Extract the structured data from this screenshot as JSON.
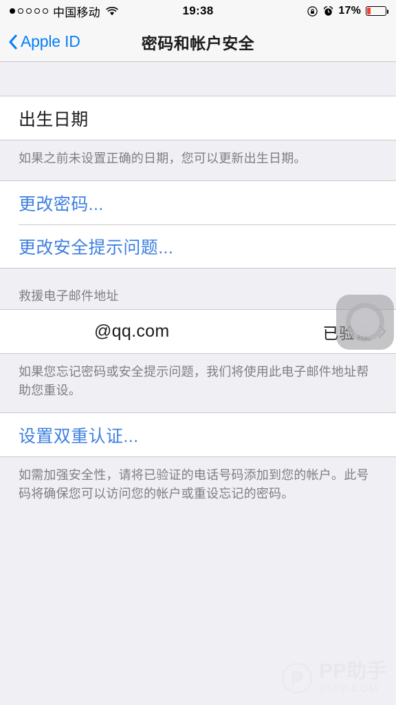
{
  "status_bar": {
    "signal_dots_total": 5,
    "signal_dots_filled": 1,
    "carrier": "中国移动",
    "wifi_icon": "wifi-icon",
    "time": "19:38",
    "rotation_lock_icon": "rotation-lock-icon",
    "alarm_icon": "alarm-clock-icon",
    "battery_percent": "17%",
    "battery_level": 17,
    "battery_color": "#FF3B30"
  },
  "navbar": {
    "back_icon": "chevron-left-icon",
    "back_label": "Apple ID",
    "title": "密码和帐户安全",
    "tint_color": "#067EF5"
  },
  "sections": {
    "birthday": {
      "cell_label": "出生日期",
      "footer": "如果之前未设置正确的日期，您可以更新出生日期。"
    },
    "security_actions": {
      "change_password": "更改密码...",
      "change_questions": "更改安全提示问题..."
    },
    "rescue_email": {
      "header": "救援电子邮件地址",
      "value": "@qq.com",
      "status": "已验证",
      "disclosure_icon": "chevron-right-icon",
      "footer": "如果您忘记密码或安全提示问题，我们将使用此电子邮件地址帮助您重设。"
    },
    "two_factor": {
      "setup_label": "设置双重认证...",
      "footer": "如需加强安全性，请将已验证的电话号码添加到您的帐户。此号码将确保您可以访问您的帐户或重设忘记的密码。"
    }
  },
  "assistive_touch": {
    "icon": "assistive-touch-icon"
  },
  "watermark": {
    "logo_icon": "pp-logo-icon",
    "title": "PP助手",
    "subtitle": "25PP.COM"
  }
}
